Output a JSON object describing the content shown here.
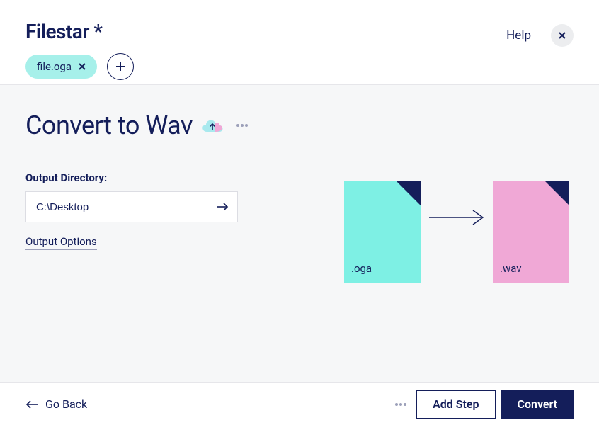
{
  "brand": "Filestar *",
  "header": {
    "help": "Help"
  },
  "files": [
    {
      "name": "file.oga"
    }
  ],
  "page": {
    "title": "Convert to Wav"
  },
  "form": {
    "output_dir_label": "Output Directory:",
    "output_dir_value": "C:\\Desktop",
    "options_link": "Output Options"
  },
  "conversion": {
    "src_ext": ".oga",
    "dst_ext": ".wav"
  },
  "footer": {
    "go_back": "Go Back",
    "add_step": "Add Step",
    "convert": "Convert"
  },
  "colors": {
    "brand_navy": "#141e5a",
    "chip_teal": "#a6f0ea",
    "file_src": "#7ef0e4",
    "file_dst": "#f0a8d6",
    "panel_bg": "#f6f7f8"
  }
}
